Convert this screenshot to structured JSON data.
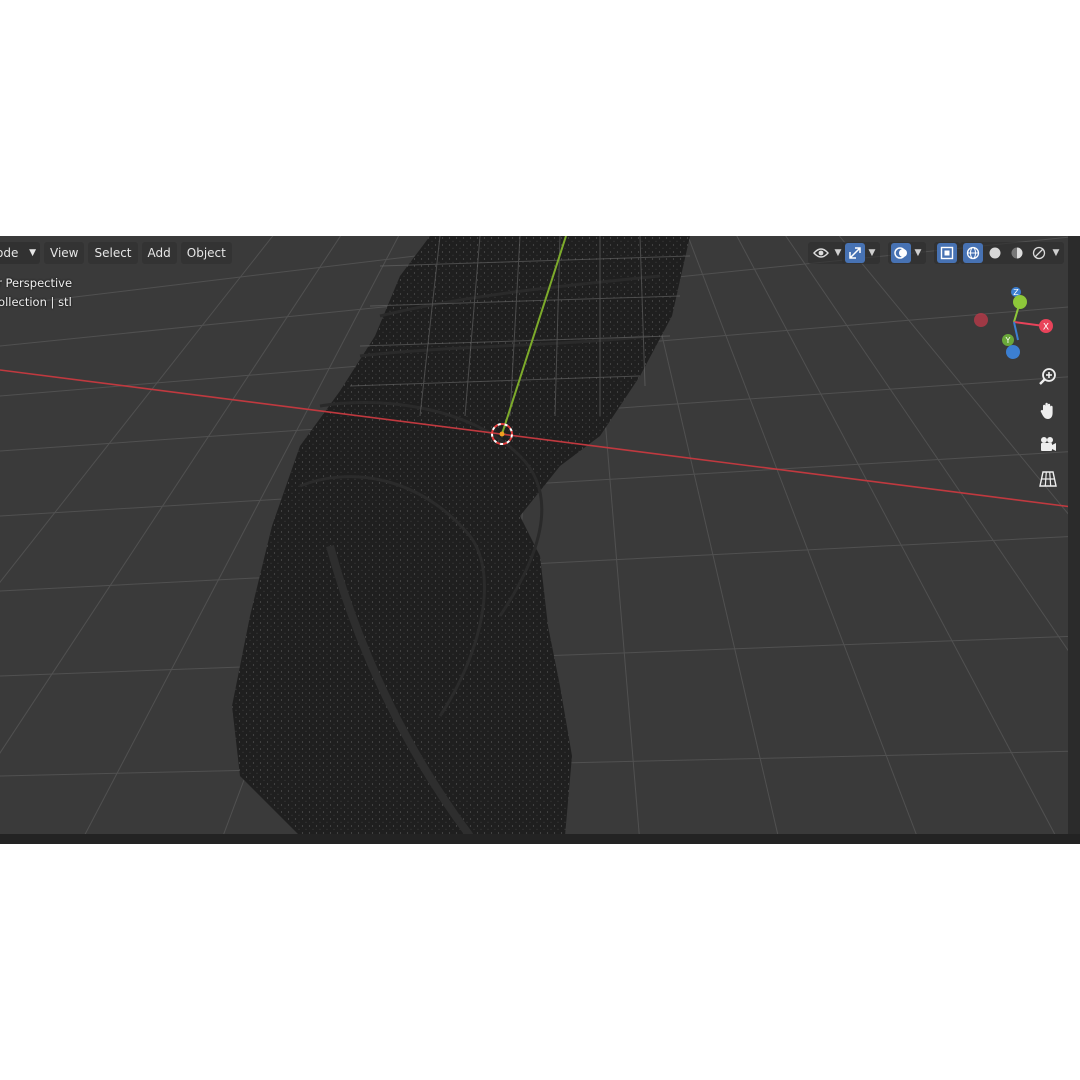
{
  "header": {
    "mode_label": "ode",
    "menu": [
      "View",
      "Select",
      "Add",
      "Object"
    ]
  },
  "overlay": {
    "view_name": "er Perspective",
    "collection": "Collection | stl"
  },
  "gizmo": {
    "axes": [
      "Z",
      "Y",
      "X"
    ]
  },
  "colors": {
    "viewport_bg": "#3a3a3a",
    "grid": "#555555",
    "x_axis": "#c0393f",
    "y_axis": "#7dab2b",
    "accent": "#4772b3",
    "gizmo_x": "#e8435a",
    "gizmo_y": "#8ec73a",
    "gizmo_z": "#3c7fd1"
  },
  "icons": {
    "visibility": "eye-icon",
    "gizmo_toggle": "transform-gizmo-icon",
    "overlays": "overlays-icon",
    "xray": "xray-icon",
    "shading": [
      "wireframe-shading-icon",
      "solid-shading-icon",
      "material-shading-icon",
      "rendered-shading-icon"
    ],
    "tools": [
      "zoom-icon",
      "hand-pan-icon",
      "camera-icon",
      "grid-icon"
    ]
  }
}
